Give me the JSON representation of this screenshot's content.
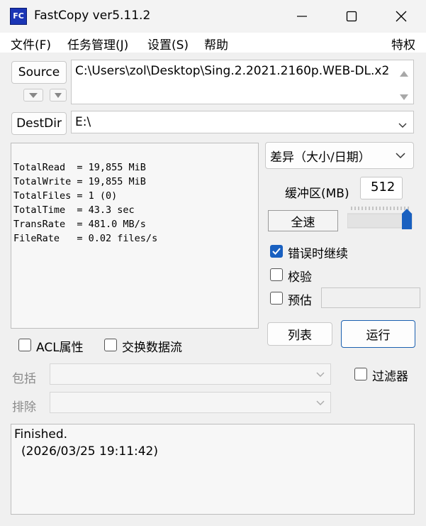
{
  "window": {
    "title": "FastCopy ver5.11.2",
    "icon_text": "FC"
  },
  "menu": [
    "文件(F)",
    "任务管理(J)",
    "设置(S)",
    "帮助"
  ],
  "menu_right": "特权",
  "source": {
    "button": "Source",
    "path": "C:\\Users\\zol\\Desktop\\Sing.2.2021.2160p.WEB-DL.x2"
  },
  "dest": {
    "button": "DestDir",
    "path": "E:\\"
  },
  "log": [
    "TotalRead  = 19,855 MiB",
    "TotalWrite = 19,855 MiB",
    "TotalFiles = 1 (0)",
    "TotalTime  = 43.3 sec",
    "TransRate  = 481.0 MB/s",
    "FileRate   = 0.02 files/s"
  ],
  "mode": "差异（大小/日期）",
  "buffer": {
    "label": "缓冲区(MB)",
    "value": "512"
  },
  "speed": {
    "label": "全速",
    "level": 1.0
  },
  "options": {
    "continue_on_error": {
      "label": "错误时继续",
      "checked": true
    },
    "verify": {
      "label": "校验",
      "checked": false
    },
    "estimate": {
      "label": "预估",
      "checked": false
    }
  },
  "buttons": {
    "list": "列表",
    "run": "运行"
  },
  "acl": {
    "label": "ACL属性",
    "checked": false
  },
  "streams": {
    "label": "交换数据流",
    "checked": false
  },
  "include": {
    "label": "包括"
  },
  "exclude": {
    "label": "排除"
  },
  "filter": {
    "label": "过滤器",
    "checked": false
  },
  "status": {
    "line1": "Finished.",
    "line2": "(2026/03/25 19:11:42)"
  }
}
